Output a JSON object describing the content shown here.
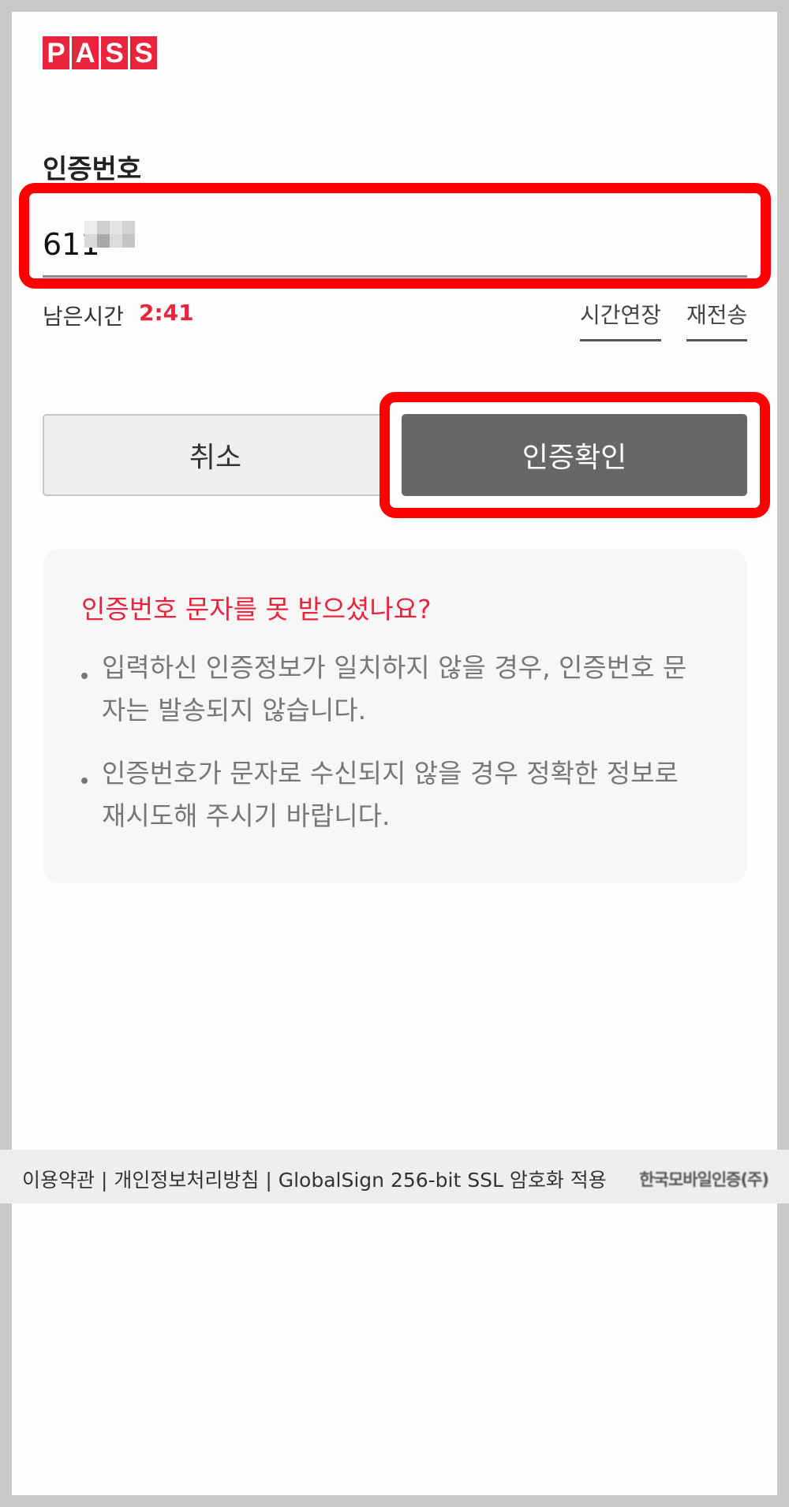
{
  "header": {
    "logo_letters": [
      "P",
      "A",
      "S",
      "S"
    ]
  },
  "form": {
    "label": "인증번호",
    "code_value": "611",
    "timer_label": "남은시간",
    "timer_value": "2:41",
    "extend_label": "시간연장",
    "resend_label": "재전송"
  },
  "buttons": {
    "cancel": "취소",
    "confirm": "인증확인"
  },
  "help": {
    "title": "인증번호 문자를 못 받으셨나요?",
    "items": [
      "입력하신 인증정보가 일치하지 않을 경우, 인증번호 문자는 발송되지 않습니다.",
      "인증번호가 문자로 수신되지 않을 경우 정확한 정보로 재시도해 주시기 바랍니다."
    ]
  },
  "footer": {
    "terms": "이용약관",
    "privacy": "개인정보처리방침",
    "ssl_note": "GlobalSign 256-bit SSL 암호화 적용",
    "separator": "|",
    "company": "한국모바일인증(주)"
  },
  "colors": {
    "brand": "#e8253c",
    "highlight": "#fe0000",
    "confirm_button": "#676767",
    "cancel_button": "#efefef",
    "help_background": "#f7f7f7"
  }
}
